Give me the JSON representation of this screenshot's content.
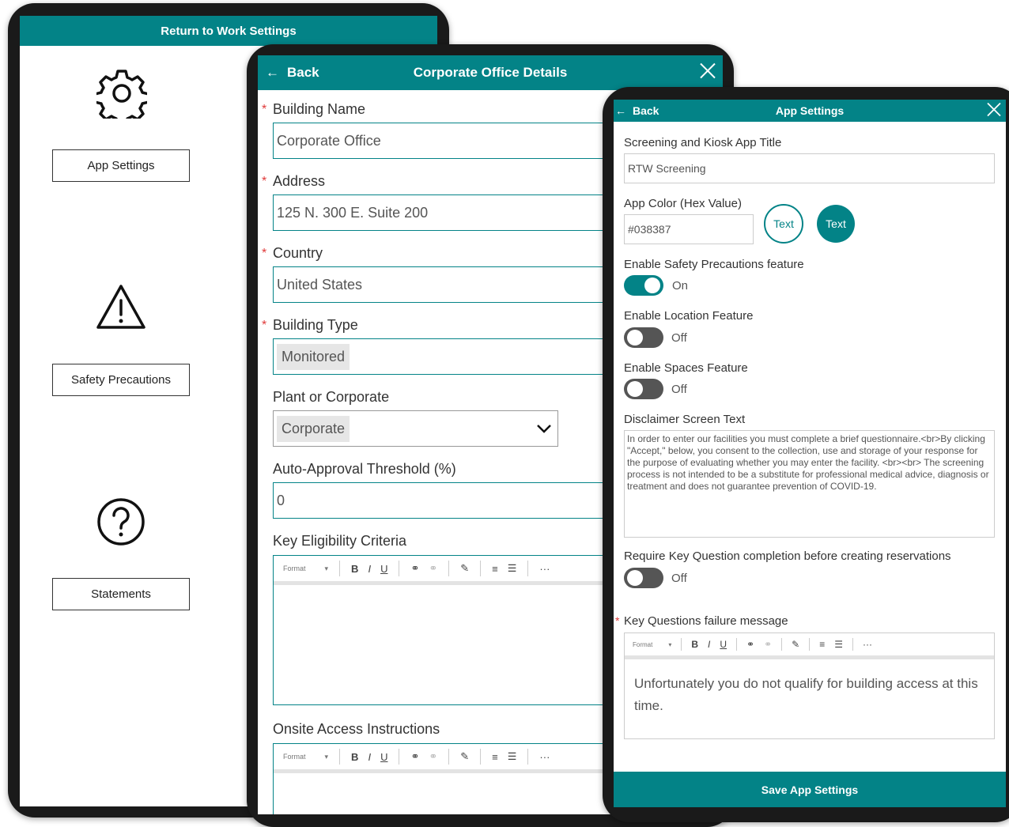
{
  "colors": {
    "accent": "#038387"
  },
  "rtw": {
    "title": "Return to Work Settings",
    "app_settings_label": "App Settings",
    "safety_label": "Safety Precautions",
    "statements_label": "Statements",
    "icons": [
      "gear-icon",
      "warning-icon",
      "question-icon"
    ]
  },
  "corp": {
    "back_label": "Back",
    "title": "Corporate Office Details",
    "building_name_label": "Building Name",
    "building_name_value": "Corporate Office",
    "address_label": "Address",
    "address_value": "125 N. 300 E. Suite 200",
    "country_label": "Country",
    "country_value": "United States",
    "building_type_label": "Building Type",
    "building_type_value": "Monitored",
    "plant_label": "Plant or Corporate",
    "plant_value": "Corporate",
    "threshold_label": "Auto-Approval Threshold (%)",
    "threshold_value": "0",
    "eligibility_label": "Key Eligibility Criteria",
    "onsite_label": "Onsite Access Instructions",
    "format_label": "Format"
  },
  "app": {
    "back_label": "Back",
    "title": "App Settings",
    "app_title_label": "Screening and Kiosk App Title",
    "app_title_value": "RTW Screening",
    "color_label": "App Color (Hex Value)",
    "color_value": "#038387",
    "text_sample": "Text",
    "safety_label": "Enable Safety Precautions feature",
    "safety_state": "On",
    "location_label": "Enable Location Feature",
    "location_state": "Off",
    "spaces_label": "Enable Spaces Feature",
    "spaces_state": "Off",
    "disclaimer_label": "Disclaimer Screen Text",
    "disclaimer_value": "In order to enter our facilities you must complete a brief questionnaire.<br>By clicking \"Accept,\" below, you consent to the collection, use and storage of your response for the purpose of evaluating whether you may enter the facility. <br><br> The screening process is not intended to be a substitute for professional medical advice, diagnosis or treatment and does not guarantee prevention of COVID-19.",
    "require_label": "Require Key Question completion before creating reservations",
    "require_state": "Off",
    "failure_label": "Key Questions failure message",
    "failure_value": "Unfortunately you do not qualify for building access at this time.",
    "format_label": "Format",
    "save_label": "Save App Settings"
  }
}
